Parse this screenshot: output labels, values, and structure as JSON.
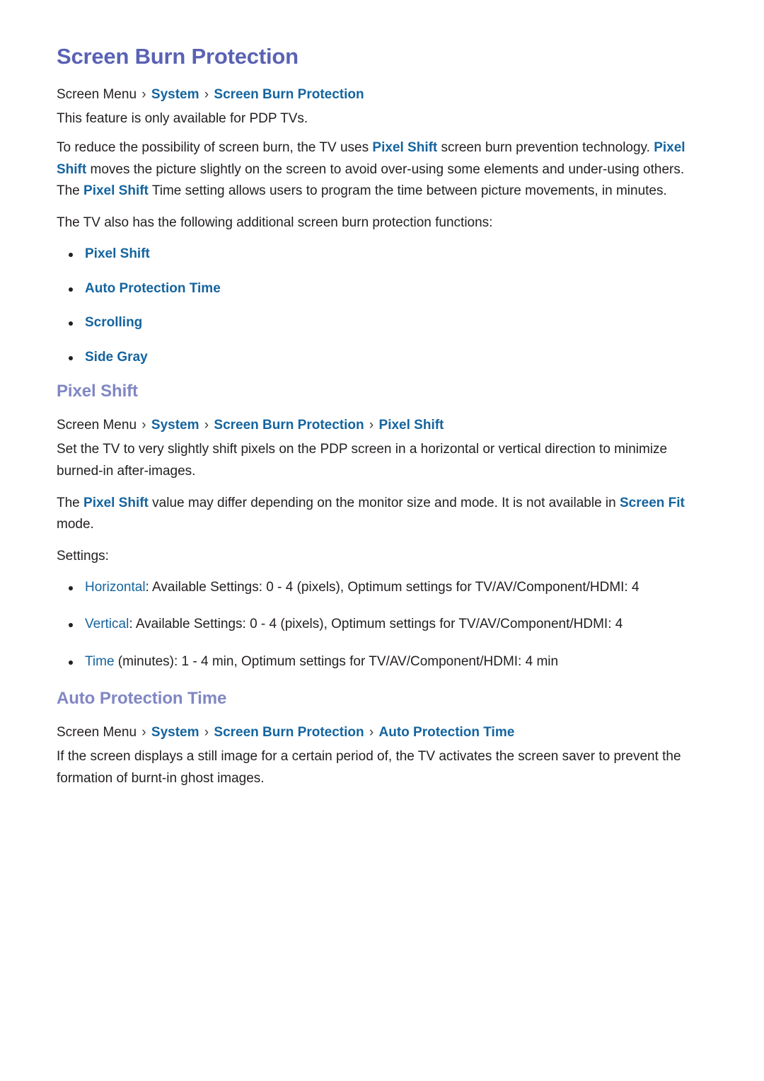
{
  "colors": {
    "doc_title": "#5a62b4",
    "section_title": "#8187c3",
    "link_blue": "#14649f",
    "body_text": "#231f20",
    "background": "#ffffff"
  },
  "doc": {
    "title": "Screen Burn Protection"
  },
  "breadcrumbs": {
    "main": {
      "root": "Screen Menu",
      "sep": "›",
      "links": [
        "System",
        "Screen Burn Protection"
      ]
    },
    "pixel_shift": {
      "root": "Screen Menu",
      "sep": "›",
      "links": [
        "System",
        "Screen Burn Protection",
        "Pixel Shift"
      ]
    },
    "auto_protection_time": {
      "root": "Screen Menu",
      "sep": "›",
      "links": [
        "System",
        "Screen Burn Protection",
        "Auto Protection Time"
      ]
    }
  },
  "intro": {
    "availability": "This feature is only available for PDP TVs.",
    "para1": {
      "t1": "To reduce the possibility of screen burn, the TV uses ",
      "l1": "Pixel Shift",
      "t2": " screen burn prevention technology. ",
      "l2": "Pixel Shift",
      "t3": " moves the picture slightly on the screen to avoid over-using some elements and under-using others. The ",
      "l3": "Pixel Shift",
      "t4": " Time setting allows users to program the time between picture movements, in minutes."
    },
    "para2": "The TV also has the following additional screen burn protection functions:",
    "functions": [
      "Pixel Shift",
      "Auto Protection Time",
      "Scrolling",
      "Side Gray"
    ]
  },
  "pixel_shift_section": {
    "heading": "Pixel Shift",
    "para1": "Set the TV to very slightly shift pixels on the PDP screen in a horizontal or vertical direction to minimize burned-in after-images.",
    "para2": {
      "t1": "The ",
      "l1": "Pixel Shift",
      "t2": " value may differ depending on the monitor size and mode. It is not available in ",
      "l2": "Screen Fit",
      "t3": " mode."
    },
    "settings_label": "Settings:",
    "settings": [
      {
        "keyword": "Horizontal",
        "rest": ": Available Settings: 0 - 4 (pixels), Optimum settings for TV/AV/Component/HDMI: 4"
      },
      {
        "keyword": "Vertical",
        "rest": ": Available Settings: 0 - 4 (pixels), Optimum settings for TV/AV/Component/HDMI: 4"
      },
      {
        "keyword": "Time",
        "rest": " (minutes): 1 - 4 min, Optimum settings for TV/AV/Component/HDMI: 4 min"
      }
    ]
  },
  "auto_protection_section": {
    "heading": "Auto Protection Time",
    "para1": "If the screen displays a still image for a certain period of, the TV activates the screen saver to prevent the formation of burnt-in ghost images."
  }
}
